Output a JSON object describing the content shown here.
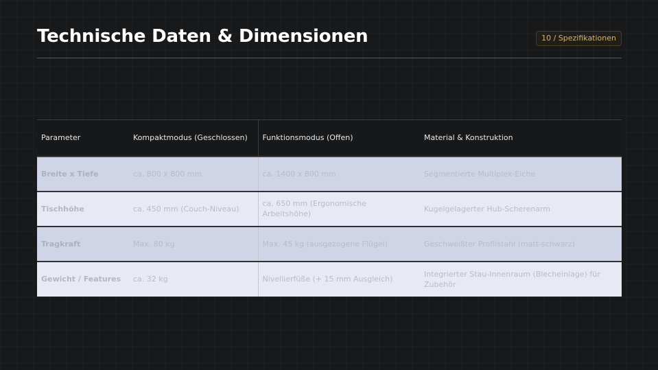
{
  "header": {
    "title": "Technische Daten & Dimensionen",
    "badge": "10 / Spezifikationen"
  },
  "table": {
    "columns": [
      "Parameter",
      "Kompaktmodus (Geschlossen)",
      "Funktionsmodus (Offen)",
      "Material & Konstruktion"
    ],
    "rows": [
      {
        "parameter": "Breite x Tiefe",
        "kompakt": "ca. 800 x 800 mm",
        "funktion": "ca. 1400 x 800 mm",
        "material": "Segmentierte Multiplex-Eiche"
      },
      {
        "parameter": "Tischhöhe",
        "kompakt": "ca. 450 mm (Couch-Niveau)",
        "funktion": "ca. 650 mm (Ergonomische Arbeitshöhe)",
        "material": "Kugelgelagerter Hub-Scherenarm"
      },
      {
        "parameter": "Tragkraft",
        "kompakt": "Max. 80 kg",
        "funktion": "Max. 45 kg (ausgezogene Flügel)",
        "material": "Geschweißter Profilstahl (matt-schwarz)"
      },
      {
        "parameter": "Gewicht / Features",
        "kompakt": "ca. 32 kg",
        "funktion": "Nivellierfüße (+ 15 mm Ausgleich)",
        "material": "Integrierter Stau-Innenraum (Blecheinlage) für Zubehör"
      }
    ]
  }
}
